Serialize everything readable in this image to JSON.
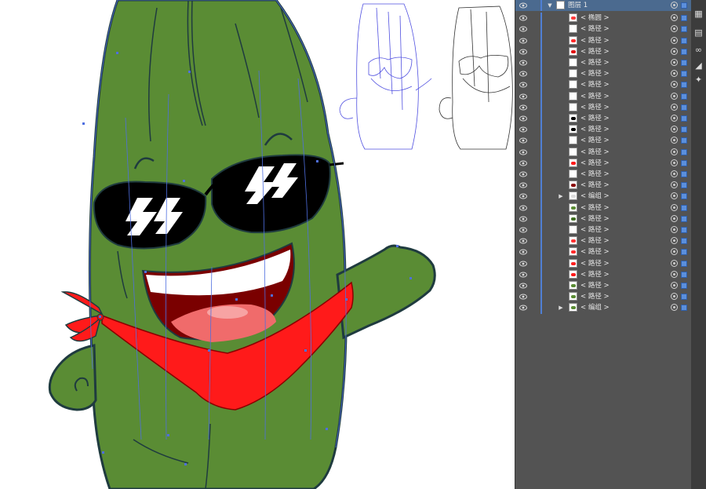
{
  "layers_panel": {
    "layer_name": "图层 1",
    "items": [
      {
        "label": "< 椭圆 >",
        "thumb": "red-ellipse",
        "expandable": false
      },
      {
        "label": "< 路径 >",
        "thumb": "line",
        "expandable": false
      },
      {
        "label": "< 路径 >",
        "thumb": "red-line",
        "expandable": false
      },
      {
        "label": "< 路径 >",
        "thumb": "red-check",
        "expandable": false
      },
      {
        "label": "< 路径 >",
        "thumb": "arc",
        "expandable": false
      },
      {
        "label": "< 路径 >",
        "thumb": "curve",
        "expandable": false
      },
      {
        "label": "< 路径 >",
        "thumb": "small-arc",
        "expandable": false
      },
      {
        "label": "< 路径 >",
        "thumb": "line",
        "expandable": false
      },
      {
        "label": "< 路径 >",
        "thumb": "line",
        "expandable": false
      },
      {
        "label": "< 路径 >",
        "thumb": "black-blob",
        "expandable": false
      },
      {
        "label": "< 路径 >",
        "thumb": "black-blob",
        "expandable": false
      },
      {
        "label": "< 路径 >",
        "thumb": "line",
        "expandable": false
      },
      {
        "label": "< 路径 >",
        "thumb": "diagonal",
        "expandable": false
      },
      {
        "label": "< 路径 >",
        "thumb": "red-blob",
        "expandable": false
      },
      {
        "label": "< 路径 >",
        "thumb": "line",
        "expandable": false
      },
      {
        "label": "< 路径 >",
        "thumb": "dark-red",
        "expandable": false
      },
      {
        "label": "< 编组 >",
        "thumb": "group",
        "expandable": true
      },
      {
        "label": "< 路径 >",
        "thumb": "green-leaf",
        "expandable": false
      },
      {
        "label": "< 路径 >",
        "thumb": "green-stroke",
        "expandable": false
      },
      {
        "label": "< 路径 >",
        "thumb": "line",
        "expandable": false
      },
      {
        "label": "< 路径 >",
        "thumb": "red-stroke",
        "expandable": false
      },
      {
        "label": "< 路径 >",
        "thumb": "red-line",
        "expandable": false
      },
      {
        "label": "< 路径 >",
        "thumb": "red-curve",
        "expandable": false
      },
      {
        "label": "< 路径 >",
        "thumb": "red-blob",
        "expandable": false
      },
      {
        "label": "< 路径 >",
        "thumb": "green-body",
        "expandable": false
      },
      {
        "label": "< 路径 >",
        "thumb": "green-leaf",
        "expandable": false
      },
      {
        "label": "< 编组 >",
        "thumb": "green-group",
        "expandable": true
      }
    ]
  },
  "toolbar": {
    "tools": [
      "cube-icon",
      "layers-icon",
      "links-icon",
      "artboard-icon",
      "magic-wand-icon"
    ]
  },
  "colors": {
    "body_green": "#5a8c34",
    "outline": "#1f3b3f",
    "bandana_red": "#ff1a1a",
    "path_blue": "#4f6fe0",
    "panel_bg": "#535353",
    "selected_row": "#4b6a8f"
  }
}
